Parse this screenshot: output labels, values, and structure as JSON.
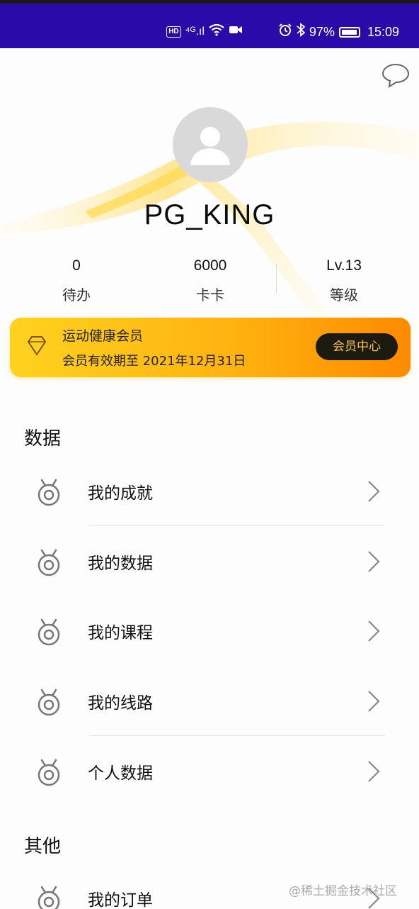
{
  "status_bar": {
    "battery": "97%",
    "time": "15:09",
    "hd_label": "HD",
    "signal_label": "⁴ᴳ.ıl"
  },
  "profile": {
    "username": "PG_KING",
    "stats": [
      {
        "value": "0",
        "label": "待办"
      },
      {
        "value": "6000",
        "label": "卡卡"
      },
      {
        "value": "Lv.13",
        "label": "等级"
      }
    ]
  },
  "membership": {
    "title": "运动健康会员",
    "subtitle": "会员有效期至 2021年12月31日",
    "button_label": "会员中心"
  },
  "sections": [
    {
      "title": "数据",
      "items": [
        {
          "label": "我的成就"
        },
        {
          "label": "我的数据"
        },
        {
          "label": "我的课程"
        },
        {
          "label": "我的线路"
        },
        {
          "label": "个人数据"
        }
      ]
    },
    {
      "title": "其他",
      "items": [
        {
          "label": "我的订单"
        }
      ]
    }
  ],
  "watermark": "@稀土掘金技术社区",
  "colors": {
    "status_bar": "#2a0aa8",
    "member_gradient_start": "#ffd21f",
    "member_gradient_end": "#ff8a00",
    "member_button_bg": "#1d1a10",
    "member_button_text": "#f6c24a"
  }
}
